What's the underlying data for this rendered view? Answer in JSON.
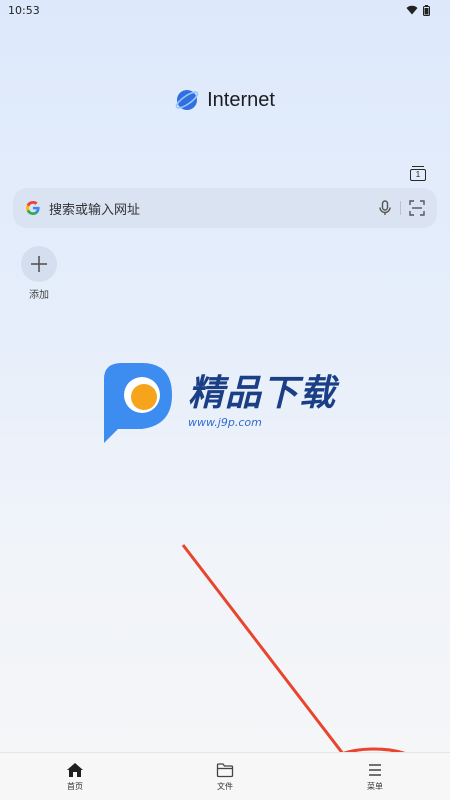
{
  "status_bar": {
    "time": "10:53"
  },
  "brand": {
    "name": "Internet",
    "accent": "#2f6fe0"
  },
  "tabs": {
    "count": "1"
  },
  "search": {
    "placeholder": "搜索或输入网址"
  },
  "shortcuts": {
    "add_label": "添加"
  },
  "watermark": {
    "title": "精品下载",
    "url": "www.j9p.com"
  },
  "bottom_nav": {
    "items": [
      {
        "label": "首页",
        "icon": "home-icon"
      },
      {
        "label": "文件",
        "icon": "folder-icon"
      },
      {
        "label": "菜单",
        "icon": "menu-icon"
      }
    ]
  },
  "annotation": {
    "color": "#e8442e"
  }
}
